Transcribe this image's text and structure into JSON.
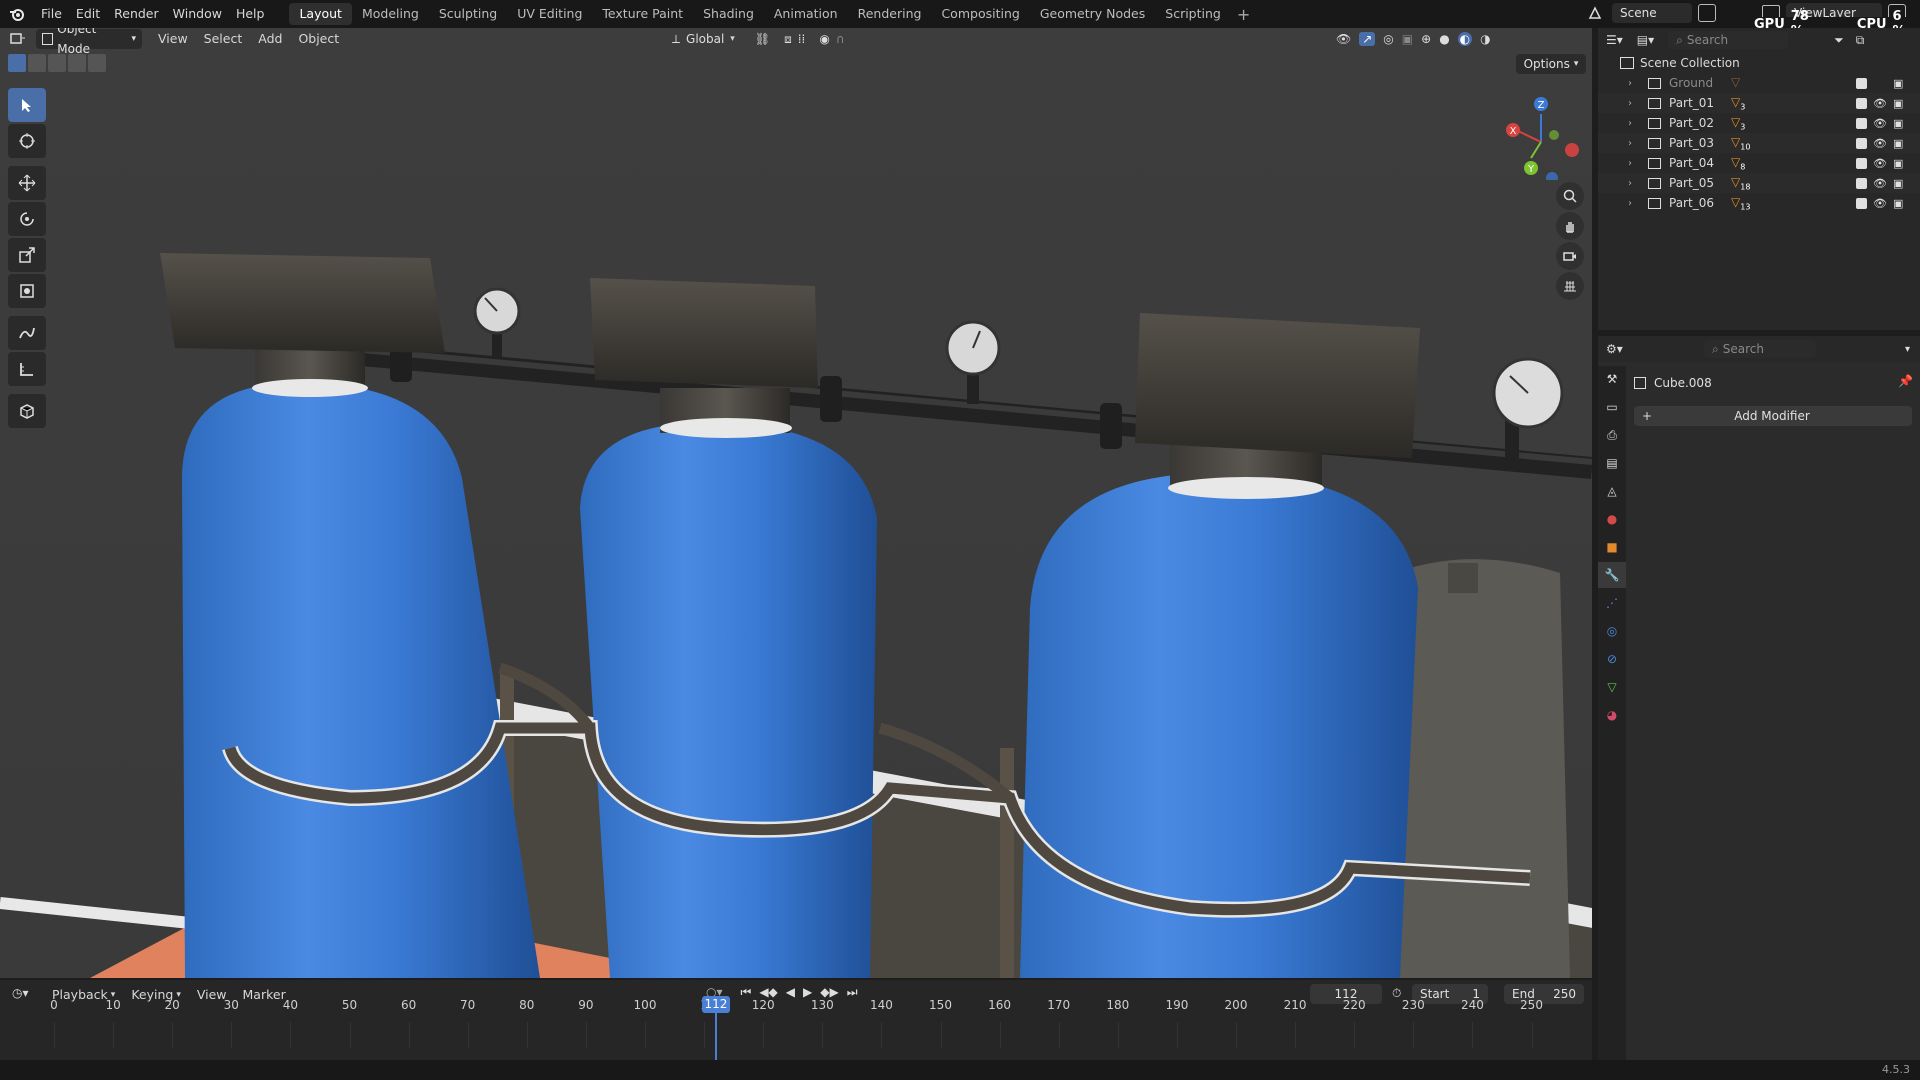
{
  "topbar": {
    "menus": [
      "File",
      "Edit",
      "Render",
      "Window",
      "Help"
    ],
    "workspaces": [
      "Layout",
      "Modeling",
      "Sculpting",
      "UV Editing",
      "Texture Paint",
      "Shading",
      "Animation",
      "Rendering",
      "Compositing",
      "Geometry Nodes",
      "Scripting"
    ],
    "active_workspace": "Layout",
    "add_tab": "+",
    "scene": "Scene",
    "view_layer": "ViewLayer",
    "gpu_label": "GPU",
    "gpu_value": "78 %",
    "cpu_label": "CPU",
    "cpu_value": "6 %"
  },
  "viewport": {
    "mode": "Object Mode",
    "menus": [
      "View",
      "Select",
      "Add",
      "Object"
    ],
    "transform_orientation": "Global",
    "options": "Options",
    "gizmo": {
      "x": "X",
      "y": "Y",
      "z": "Z"
    }
  },
  "outliner": {
    "search_placeholder": "Search",
    "root": "Scene Collection",
    "items": [
      {
        "name": "Ground",
        "badge": ""
      },
      {
        "name": "Part_01",
        "badge": "3"
      },
      {
        "name": "Part_02",
        "badge": "3"
      },
      {
        "name": "Part_03",
        "badge": "10"
      },
      {
        "name": "Part_04",
        "badge": "8"
      },
      {
        "name": "Part_05",
        "badge": "18"
      },
      {
        "name": "Part_06",
        "badge": "13"
      }
    ]
  },
  "properties": {
    "search_placeholder": "Search",
    "object_name": "Cube.008",
    "add_modifier": "Add Modifier"
  },
  "timeline": {
    "menus": [
      "Playback",
      "Keying",
      "View",
      "Marker"
    ],
    "current_frame": "112",
    "start_label": "Start",
    "start_value": "1",
    "end_label": "End",
    "end_value": "250",
    "ticks": [
      "0",
      "10",
      "20",
      "30",
      "40",
      "50",
      "60",
      "70",
      "80",
      "90",
      "100",
      "1",
      "120",
      "130",
      "140",
      "150",
      "160",
      "170",
      "180",
      "190",
      "200",
      "210",
      "220",
      "230",
      "240",
      "250"
    ]
  },
  "statusbar": {
    "version": "4.5.3"
  },
  "colors": {
    "accent": "#4a6ea8",
    "tank_blue": "#3a7fd8",
    "playhead": "#4a7fd6"
  }
}
